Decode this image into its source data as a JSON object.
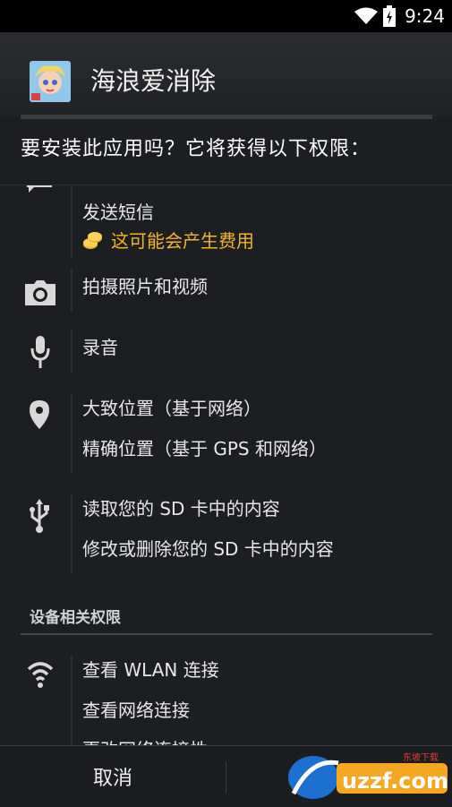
{
  "status": {
    "time": "9:24"
  },
  "app": {
    "title": "海浪爱消除"
  },
  "prompt": "要安装此应用吗？它将获得以下权限：",
  "permissions": {
    "sms": {
      "label": "发送短信",
      "cost_warning": "这可能会产生费用"
    },
    "camera": {
      "label": "拍摄照片和视频"
    },
    "audio": {
      "label": "录音"
    },
    "location": {
      "coarse": "大致位置（基于网络）",
      "fine": "精确位置（基于 GPS 和网络）"
    },
    "storage": {
      "read": "读取您的 SD 卡中的内容",
      "modify": "修改或删除您的 SD 卡中的内容"
    }
  },
  "device_section": {
    "title": "设备相关权限",
    "wlan": "查看 WLAN 连接",
    "network": "查看网络连接",
    "partial": "更改网络连接性"
  },
  "buttons": {
    "cancel": "取消"
  },
  "watermark": {
    "brand": "uzzf.com",
    "tag": "东坡下载"
  },
  "colors": {
    "warning": "#f5b428",
    "background": "#1c1e21"
  }
}
